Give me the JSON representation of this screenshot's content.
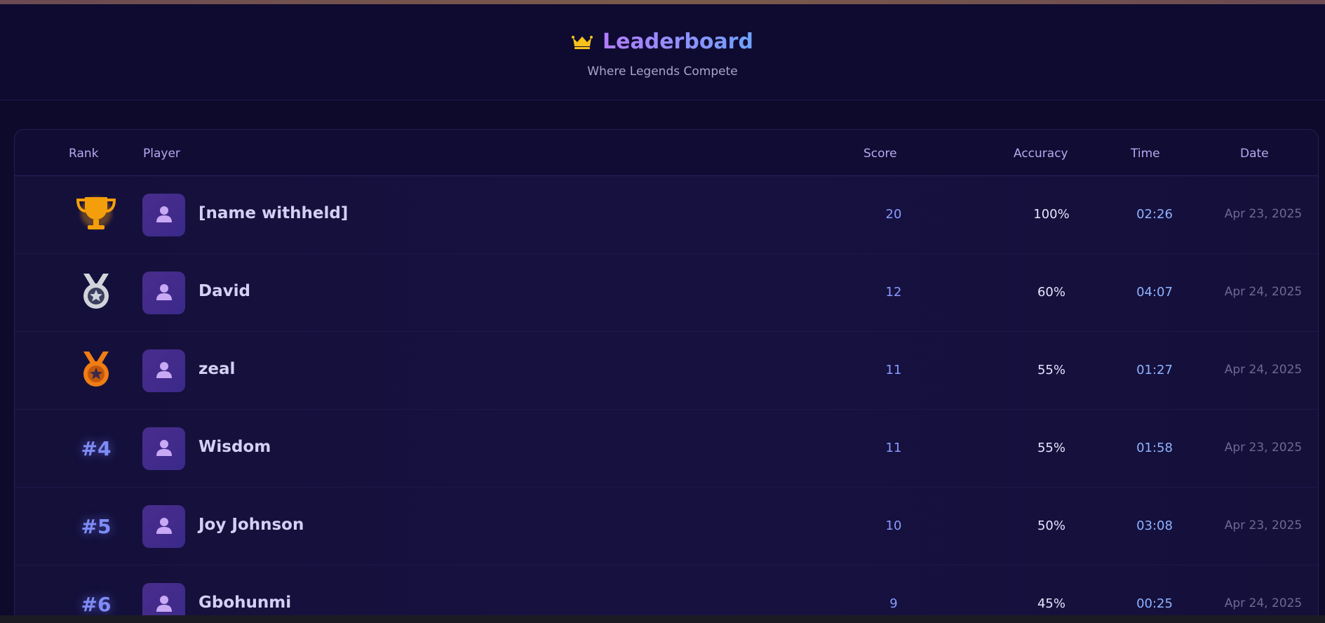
{
  "header": {
    "title": "Leaderboard",
    "subtitle": "Where Legends Compete",
    "crown_icon": "crown-icon",
    "accent_colors": [
      "#b27cff",
      "#6fa2ff"
    ]
  },
  "table": {
    "columns": {
      "rank": "Rank",
      "player": "Player",
      "score": "Score",
      "accuracy": "Accuracy",
      "time": "Time",
      "date": "Date"
    },
    "rows": [
      {
        "rank": "1",
        "rank_icon": "trophy-icon",
        "player": "[name withheld]",
        "score": "20",
        "accuracy": "100%",
        "time": "02:26",
        "date": "Apr 23, 2025"
      },
      {
        "rank": "2",
        "rank_icon": "silver-medal-icon",
        "player": "David",
        "score": "12",
        "accuracy": "60%",
        "time": "04:07",
        "date": "Apr 24, 2025"
      },
      {
        "rank": "3",
        "rank_icon": "bronze-medal-icon",
        "player": "zeal",
        "score": "11",
        "accuracy": "55%",
        "time": "01:27",
        "date": "Apr 24, 2025"
      },
      {
        "rank": "#4",
        "player": "Wisdom",
        "score": "11",
        "accuracy": "55%",
        "time": "01:58",
        "date": "Apr 23, 2025"
      },
      {
        "rank": "#5",
        "player": "Joy Johnson",
        "score": "10",
        "accuracy": "50%",
        "time": "03:08",
        "date": "Apr 23, 2025"
      },
      {
        "rank": "#6",
        "player": "Gbohunmi",
        "score": "9",
        "accuracy": "45%",
        "time": "00:25",
        "date": "Apr 24, 2025"
      }
    ]
  }
}
